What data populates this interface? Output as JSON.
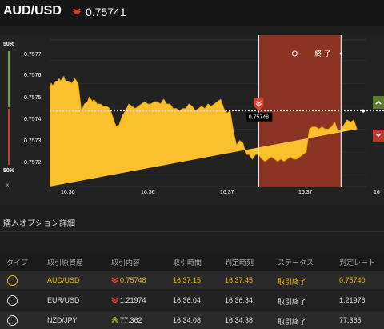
{
  "header": {
    "pair": "AUD/USD",
    "price": "0.75741"
  },
  "chart": {
    "sidebar_top": "50%",
    "sidebar_bottom": "50%",
    "close_label": "×",
    "price_tag": "0.75748",
    "end_label": "終 了",
    "y_ticks": [
      "0.7577",
      "0.7576",
      "0.7575",
      "0.7574",
      "0.7573",
      "0.7572"
    ],
    "x_ticks": [
      "16:36",
      "16:36",
      "16:37",
      "16:37",
      "16"
    ]
  },
  "chart_data": {
    "type": "area",
    "ylim": [
      0.75715,
      0.75779
    ],
    "x": [
      0,
      0.5,
      1,
      1.5,
      2,
      2.5,
      3,
      3.5,
      4,
      4.5,
      5,
      6,
      7,
      8,
      9,
      10,
      11,
      12,
      12.5,
      13,
      13.5,
      14,
      15,
      16,
      17,
      18,
      19,
      20,
      21,
      22,
      23,
      24,
      25,
      26,
      27,
      28,
      29,
      30,
      31,
      32,
      33,
      34,
      35,
      36,
      37,
      38,
      39,
      40,
      41,
      42,
      43,
      44,
      45,
      46,
      47,
      48,
      49,
      50,
      51,
      52,
      53,
      54,
      55,
      56,
      57,
      58,
      59,
      60,
      61,
      62,
      63,
      64,
      65,
      66,
      67,
      68,
      69,
      70,
      71,
      72,
      73,
      74,
      75,
      76,
      77,
      78,
      79,
      80,
      81,
      82,
      83,
      84,
      85,
      86,
      87,
      88,
      89,
      90,
      91,
      92,
      93,
      94,
      95,
      96,
      97,
      98,
      99,
      100
    ],
    "values": [
      0.75758,
      0.7576,
      0.75759,
      0.7576,
      0.75761,
      0.75761,
      0.75762,
      0.75761,
      0.75762,
      0.75763,
      0.75761,
      0.75761,
      0.7576,
      0.75762,
      0.7576,
      0.75748,
      0.75751,
      0.75752,
      0.75754,
      0.75753,
      0.75752,
      0.75753,
      0.75751,
      0.75751,
      0.7575,
      0.7575,
      0.75749,
      0.75745,
      0.75741,
      0.75742,
      0.75746,
      0.75748,
      0.75751,
      0.7575,
      0.75749,
      0.7575,
      0.75751,
      0.75752,
      0.75751,
      0.75751,
      0.75752,
      0.75752,
      0.75751,
      0.75753,
      0.75751,
      0.75751,
      0.75749,
      0.75749,
      0.75748,
      0.75749,
      0.75749,
      0.75751,
      0.7575,
      0.75748,
      0.75749,
      0.7575,
      0.75749,
      0.75751,
      0.7575,
      0.75751,
      0.75752,
      0.75753,
      0.75749,
      0.75747,
      0.75748,
      0.75739,
      0.75733,
      0.75735,
      0.75734,
      0.75729,
      0.75729,
      0.75727,
      0.75729,
      0.75729,
      0.75727,
      0.75726,
      0.75727,
      0.75728,
      0.75727,
      0.75726,
      0.75727,
      0.75726,
      0.75727,
      0.75728,
      0.75727,
      0.75727,
      0.75728,
      0.75729,
      0.7573,
      0.7574,
      0.75741,
      0.75741,
      0.7574,
      0.75741,
      0.7574,
      0.7574,
      0.75741,
      0.75743,
      0.75739,
      0.7574,
      0.75742,
      0.75744,
      0.75743,
      0.75744,
      0.7574
    ],
    "current_price": 0.75748,
    "end_zone_start": 0.66,
    "end_zone_end": 0.92,
    "entry_marker": 0.66
  },
  "section_title": "購入オプション詳細",
  "table": {
    "headers": [
      "タイプ",
      "取引原資産",
      "取引内容",
      "取引時間",
      "判定時刻",
      "ステータス",
      "判定レート"
    ],
    "rows": [
      {
        "asset": "AUD/USD",
        "content": "0.75748",
        "time": "16:37:15",
        "judge": "16:37:45",
        "status": "取引終了",
        "rate": "0.75740",
        "dir": "down"
      },
      {
        "asset": "EUR/USD",
        "content": "1.21974",
        "time": "16:36:04",
        "judge": "16:36:34",
        "status": "取引終了",
        "rate": "1.21976",
        "dir": "down"
      },
      {
        "asset": "NZD/JPY",
        "content": "77.362",
        "time": "16:34:08",
        "judge": "16:34:38",
        "status": "取引終了",
        "rate": "77.365",
        "dir": "up"
      }
    ]
  },
  "colors": {
    "accent": "#f5b800",
    "area": "#fbc02d",
    "down": "#e0402a",
    "up": "#7cb342",
    "end_zone": "#8b3424",
    "green_btn": "#5d7d2e",
    "red_btn": "#b83a2a"
  },
  "icons": {
    "down": "down-arrow-icon",
    "up": "up-arrow-icon",
    "type": "clock-gauge-icon",
    "close": "close-icon",
    "clock": "clock-icon"
  }
}
